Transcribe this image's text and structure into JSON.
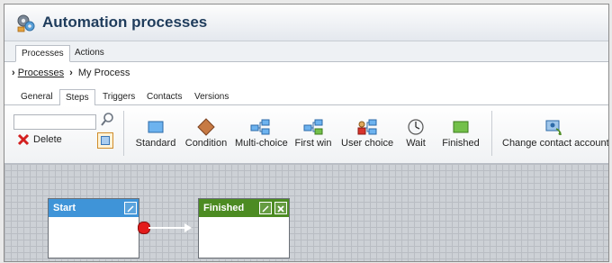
{
  "app": {
    "title": "Automation processes"
  },
  "top_tabs": [
    {
      "label": "Processes",
      "active": true
    },
    {
      "label": "Actions",
      "active": false
    }
  ],
  "breadcrumb": {
    "root": "Processes",
    "current": "My Process"
  },
  "sub_tabs": [
    {
      "label": "General",
      "active": false
    },
    {
      "label": "Steps",
      "active": true
    },
    {
      "label": "Triggers",
      "active": false
    },
    {
      "label": "Contacts",
      "active": false
    },
    {
      "label": "Versions",
      "active": false
    }
  ],
  "toolbar": {
    "search_value": "",
    "delete_label": "Delete",
    "tools": [
      {
        "label": "Standard",
        "icon": "standard-step-icon"
      },
      {
        "label": "Condition",
        "icon": "condition-step-icon"
      },
      {
        "label": "Multi-choice",
        "icon": "multi-choice-step-icon"
      },
      {
        "label": "First win",
        "icon": "first-win-step-icon"
      },
      {
        "label": "User choice",
        "icon": "user-choice-step-icon"
      },
      {
        "label": "Wait",
        "icon": "wait-step-icon"
      },
      {
        "label": "Finished",
        "icon": "finished-step-icon"
      }
    ],
    "change_contact_label": "Change contact account"
  },
  "canvas": {
    "nodes": [
      {
        "title": "Start",
        "color": "#3f94d8"
      },
      {
        "title": "Finished",
        "color": "#4c8b22"
      }
    ]
  },
  "colors": {
    "title_text": "#1f3c5c",
    "start_header": "#3f94d8",
    "finished_header": "#4c8b22",
    "connector": "#e31b1b"
  }
}
